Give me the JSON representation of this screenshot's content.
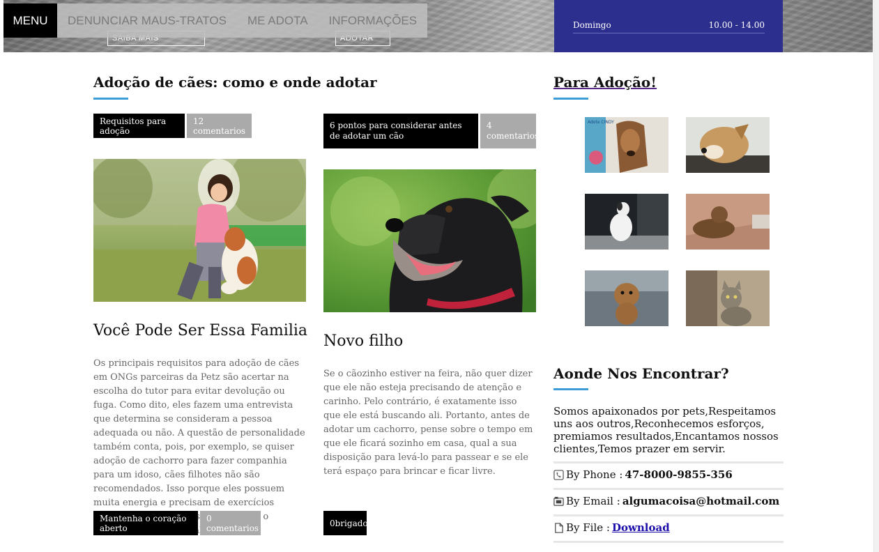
{
  "nav": {
    "menu_label": "MENU",
    "items": [
      "DENUNCIAR MAUS-TRATOS",
      "ME ADOTA",
      "INFORMAÇÕES"
    ]
  },
  "hero": {
    "button1": "SAIBA MAIS",
    "button2": "ADOTAR",
    "hours": {
      "day": "Domingo",
      "time": "10.00 - 14.00"
    }
  },
  "main": {
    "title": "Adoção de cães: como e onde adotar",
    "posts": [
      {
        "tag": "Requisitos para adoção",
        "comments": "12 comentarios",
        "title": "Você Pode Ser Essa Familia",
        "text": "Os principais requisitos para adoção de cães em ONGs parceiras da Petz são acertar na escolha do tutor para evitar devolução ou fuga. Como dito, eles fazem uma entrevista que determina se consideram a pessoa adequada ou não. A questão de personalidade também conta, pois, por exemplo, se quiser adoção de cachorro para fazer companhia para um idoso, cães filhotes não são recomendados. Isso porque eles possuem muita energia e precisam de exercícios diários. O ideal para as ONGs é unir o cachorro à família ideal.",
        "footer_tag": "Mantenha o coração aberto",
        "footer_comments": "0 comentarios"
      },
      {
        "tag": "6 pontos para considerar antes de adotar um cão",
        "comments": "4 comentarios",
        "title": "Novo filho",
        "text": "Se o cãozinho estiver na feira, não quer dizer que ele não esteja precisando de atenção e carinho. Pelo contrário, é exatamente isso que ele está buscando ali. Portanto, antes de adotar um cachorro, pense sobre o tempo em que ele ficará sozinho em casa, qual a sua disposição para levá-lo para passear e se ele terá espaço para brincar e ficar livre.",
        "footer_tag": "0brigado"
      }
    ]
  },
  "sidebar": {
    "adoption_title": "Para Adoção!",
    "thumb_caption": "Adote CINDY",
    "find_title": "Aonde Nos Encontrar?",
    "about": "Somos apaixonados por pets,Respeitamos uns aos outros,Reconhecemos esforços, premiamos resultados,Encantamos nossos clientes,Temos prazer em servir.",
    "phone_label": "By Phone :",
    "phone": "47-8000-9855-356",
    "email_label": "By Email :",
    "email": "algumacoisa@hotmail.com",
    "file_label": "By File :",
    "file_link": "Download"
  },
  "colors": {
    "accent": "#3d9bd6",
    "hours_bg": "#2d2f8e"
  }
}
